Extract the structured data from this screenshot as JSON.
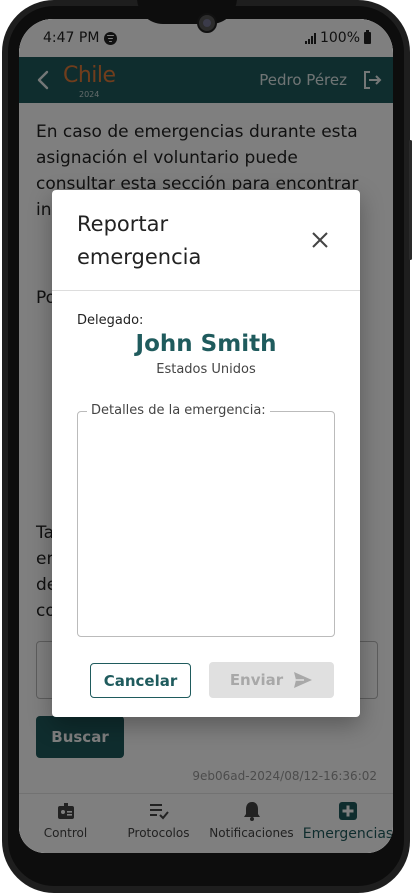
{
  "status_bar": {
    "time": "4:47 PM",
    "battery": "100%"
  },
  "header": {
    "logo_text": "Chile",
    "logo_year": "2024",
    "user_name": "Pedro Pérez"
  },
  "content": {
    "paragraph_1": "En caso de emergencias durante esta asignación el voluntario puede consultar esta sección para encontrar in fa de",
    "paragraph_2": "Po",
    "paragraph_3": "Ta en de co",
    "search_button": "Buscar",
    "version": "9eb06ad-2024/08/12-16:36:02"
  },
  "bottom_nav": [
    {
      "label": "Control",
      "icon": "badge-icon"
    },
    {
      "label": "Protocolos",
      "icon": "checklist-icon"
    },
    {
      "label": "Notificaciones",
      "icon": "bell-icon"
    },
    {
      "label": "Emergencias",
      "icon": "medical-cross-icon",
      "active": true
    }
  ],
  "modal": {
    "title": "Reportar emergencia",
    "delegate_label": "Delegado:",
    "delegate_name": "John Smith",
    "delegate_country": "Estados Unidos",
    "details_label": "Detalles de la emergencia:",
    "details_value": "",
    "cancel_label": "Cancelar",
    "send_label": "Enviar"
  },
  "colors": {
    "brand": "#1f5b5d",
    "logo_accent": "#e07b39",
    "disabled": "#e0e0e0"
  }
}
